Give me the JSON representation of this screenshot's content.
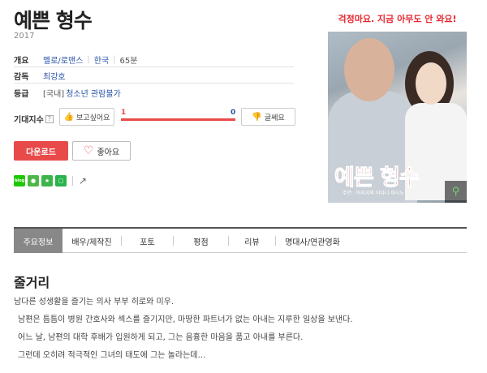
{
  "movie": {
    "title": "예쁜 형수",
    "year": "2017"
  },
  "info": {
    "overview_label": "개요",
    "genre": "멜로/로맨스",
    "country": "한국",
    "runtime": "65분",
    "director_label": "감독",
    "director": "최강호",
    "rating_label": "등급",
    "rating_bracket": "[국내]",
    "rating": "청소년 관람불가"
  },
  "expectation": {
    "label": "기대지수",
    "help": "?",
    "want_button": "보고싶어요",
    "want_count": "1",
    "meh_count": "0",
    "meh_button": "글쎄요",
    "want_ratio": 1.0
  },
  "actions": {
    "download": "다운로드",
    "like": "좋아요"
  },
  "share": {
    "icons": [
      "blog-icon",
      "kakaostory-icon",
      "bookmark-star-icon",
      "line-icon"
    ],
    "blog_text": "blog"
  },
  "poster": {
    "tagline": "걱정마요. 지금 아무도 안 와요!",
    "title": "예쁜 형수",
    "credits": "주연 : 마지지외 이다니 마시노",
    "zoom_icon": "magnifier-icon"
  },
  "tabs": [
    {
      "label": "주요정보",
      "active": true
    },
    {
      "label": "배우/제작진",
      "active": false
    },
    {
      "label": "포토",
      "active": false
    },
    {
      "label": "평점",
      "active": false
    },
    {
      "label": "리뷰",
      "active": false
    },
    {
      "label": "명대사/연관영화",
      "active": false
    }
  ],
  "synopsis": {
    "heading": "줄거리",
    "lines": [
      "남다른 성생활을 즐기는 의사 부부 히로와 미우.",
      "남편은 틈틈이 병원 간호사와 섹스를 즐기지만, 마땅한 파트너가 없는 아내는 지루한 일상을 보낸다.",
      "어느 날, 남편의 대학 후배가 입원하게 되고, 그는 음흉한 마음을 품고 아내를 부른다.",
      "그런데 오히려 적극적인 그녀의 태도에 그는 놀라는데…"
    ]
  },
  "colors": {
    "accent": "#e84a4a",
    "link": "#2a53a8"
  }
}
